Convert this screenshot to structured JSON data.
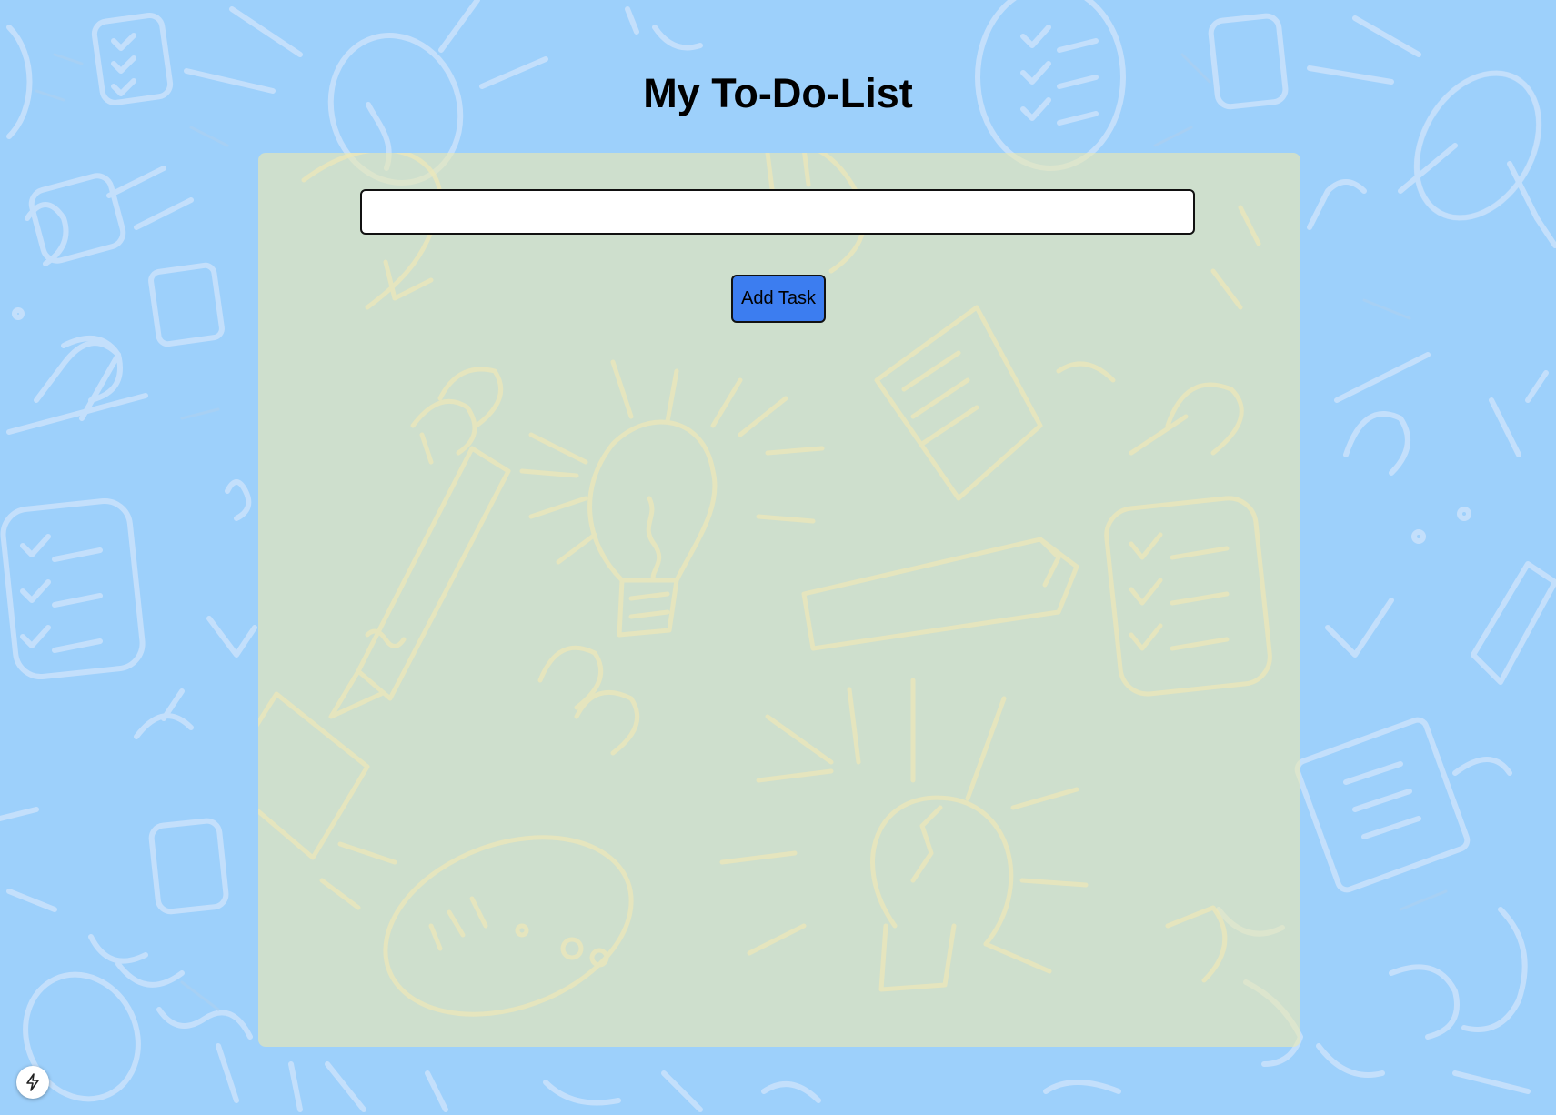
{
  "page": {
    "title": "My To-Do-List"
  },
  "task_form": {
    "input_value": "",
    "input_placeholder": "",
    "add_button_label": "Add Task"
  },
  "dev_badge": {
    "icon": "lightning-icon"
  },
  "colors": {
    "background": "#9dd0fb",
    "card_background": "#cfe2c3",
    "button_background": "#3c7df0",
    "doodle_light": "#c6e0fb",
    "doodle_card": "#e6e4b6"
  }
}
